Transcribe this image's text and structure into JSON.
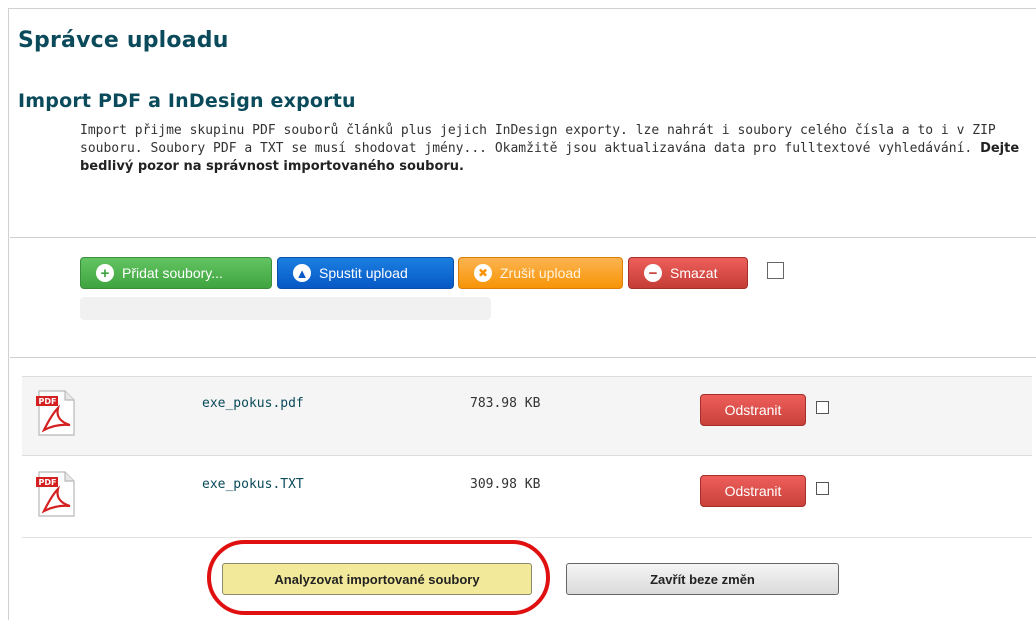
{
  "page": {
    "title": "Správce uploadu",
    "section_title": "Import PDF a InDesign exportu",
    "intro_text": "Import přijme skupinu PDF souborů článků plus jejich InDesign exporty. lze nahrát i soubory celého čísla a to i v ZIP souboru. Soubory PDF a TXT se musí shodovat jmény... Okamžitě jsou aktualizavána data pro fulltextové vyhledávání.",
    "intro_bold": "Dejte bedlivý pozor na správnost importovaného souboru."
  },
  "toolbar": {
    "add_label": "Přidat soubory...",
    "start_label": "Spustit upload",
    "cancel_label": "Zrušit upload",
    "delete_label": "Smazat"
  },
  "colors": {
    "heading": "#0a4a5a",
    "add_button": "#3fa43f",
    "start_button": "#0858c6",
    "cancel_button": "#f89406",
    "delete_button": "#c43c35",
    "highlight_oval": "#e01010"
  },
  "files": [
    {
      "icon": "pdf-file-icon",
      "name": "exe_pokus.pdf",
      "size": "783.98 KB",
      "remove_label": "Odstranit"
    },
    {
      "icon": "pdf-file-icon",
      "name": "exe_pokus.TXT",
      "size": "309.98 KB",
      "remove_label": "Odstranit"
    }
  ],
  "actions": {
    "analyze_label": "Analyzovat importované soubory",
    "close_label": "Zavřít beze změn"
  }
}
